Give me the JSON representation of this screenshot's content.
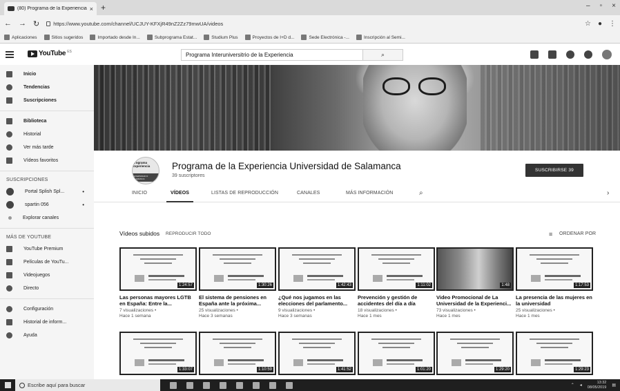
{
  "browser": {
    "tab_title": "(80) Programa de la Experiencia",
    "new_tab": "+",
    "url": "https://www.youtube.com/channel/UCJUY-KFXjR49nZ2Zz79mwUA/videos",
    "bookmarks": [
      "Aplicaciones",
      "Sitios sugeridos",
      "Importado desde In...",
      "Subprograma Estat...",
      "Studium Plus",
      "Proyectos de I+D d...",
      "Sede Electrónica -...",
      "Inscripción al Semi..."
    ]
  },
  "youtube": {
    "logo": "YouTube",
    "logo_sup": "ES",
    "search_value": "Programa Interuniversitrio de la Experiencia"
  },
  "sidebar": {
    "primary": [
      "Inicio",
      "Tendencias",
      "Suscripciones"
    ],
    "library": [
      "Biblioteca",
      "Historial",
      "Ver más tarde",
      "Vídeos favoritos"
    ],
    "subs_heading": "SUSCRIPCIONES",
    "subs": [
      "Portal Splish Spl...",
      "spartin 056",
      "Explorar canales"
    ],
    "more_heading": "MÁS DE YOUTUBE",
    "more": [
      "YouTube Premium",
      "Películas de YouTu...",
      "Videojuegos",
      "Directo"
    ],
    "settings": [
      "Configuración",
      "Historial de inform...",
      "Ayuda"
    ]
  },
  "channel": {
    "avatar_text": "Programa Experiencia",
    "avatar_band": "VNIVERSIDAD D SALAMANCA",
    "name": "Programa de la Experiencia Universidad de Salamanca",
    "subscribers": "39 suscriptores",
    "subscribe_label": "SUSCRIBIRSE 39",
    "tabs": [
      "INICIO",
      "VÍDEOS",
      "LISTAS DE REPRODUCCIÓN",
      "CANALES",
      "MÁS INFORMACIÓN"
    ]
  },
  "uploads": {
    "title": "Vídeos subidos",
    "play_all": "REPRODUCIR TODO",
    "sort_label": "ORDENAR POR"
  },
  "videos_row1": [
    {
      "title": "Las personas mayores LGTB en España: Entre la...",
      "views": "7 visualizaciones •",
      "age": "Hace 1 semana",
      "duration": "1:24:57"
    },
    {
      "title": "El sistema de pensiones en España ante la próxima...",
      "views": "25 visualizaciones •",
      "age": "Hace 3 semanas",
      "duration": "1:30:26"
    },
    {
      "title": "¿Qué nos jugamos en las elecciones del parlamento...",
      "views": "9 visualizaciones •",
      "age": "Hace 3 semanas",
      "duration": "1:42:43"
    },
    {
      "title": "Prevención y gestión de accidentes del día a día",
      "views": "18 visualizaciones •",
      "age": "Hace 1 mes",
      "duration": "1:11:02"
    },
    {
      "title": "Video Promocional de La Universidad de la Experienci...",
      "views": "73 visualizaciones •",
      "age": "Hace 1 mes",
      "duration": "1:48"
    },
    {
      "title": "La presencia de las mujeres en la universidad",
      "views": "25 visualizaciones •",
      "age": "Hace 1 mes",
      "duration": "1:17:53"
    }
  ],
  "videos_row2": [
    {
      "duration": "1:33:07"
    },
    {
      "duration": "1:10:59"
    },
    {
      "duration": "1:41:52"
    },
    {
      "duration": "1:01:20"
    },
    {
      "duration": "1:29:20"
    },
    {
      "duration": "1:29:23"
    }
  ],
  "taskbar": {
    "search_placeholder": "Escribe aquí para buscar",
    "time": "13:32",
    "date": "08/05/2019"
  }
}
